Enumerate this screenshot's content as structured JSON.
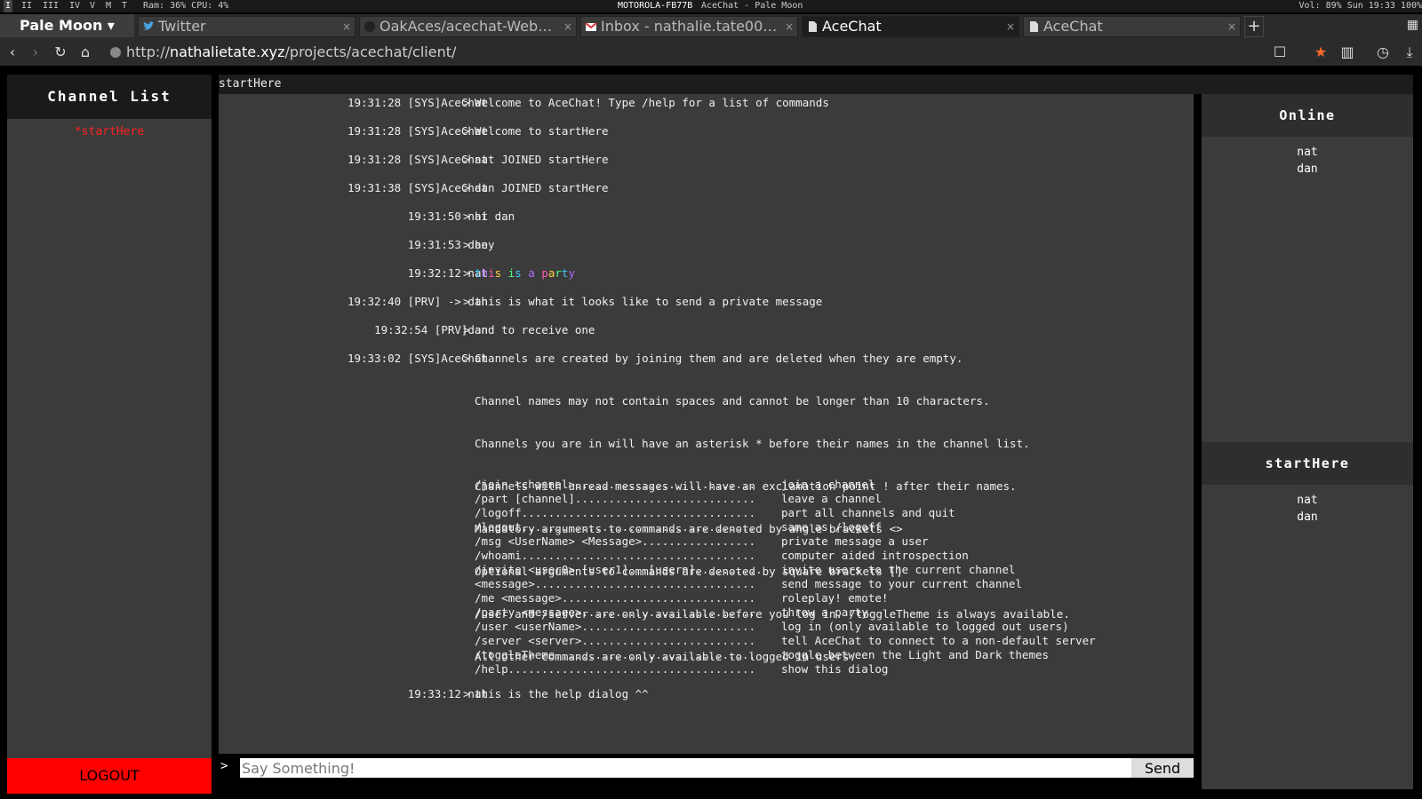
{
  "wm": {
    "workspaces": [
      "I",
      "II",
      "III",
      "IV",
      "V",
      "M",
      "T"
    ],
    "stats": "Ram: 36% CPU: 4%",
    "title": "MOTOROLA-FB77B",
    "title_app": "AceChat - Pale Moon",
    "right": "Vol: 89% Sun 19:33 100%"
  },
  "browser": {
    "app_menu": "Pale Moon ▾",
    "tabs": [
      {
        "label": "Twitter"
      },
      {
        "label": "OakAces/acechat-WebCli..."
      },
      {
        "label": "Inbox - nathalie.tate00@..."
      },
      {
        "label": "AceChat"
      },
      {
        "label": "AceChat"
      }
    ],
    "url_domain": "nathalietate.xyz",
    "url_prefix": "http://",
    "url_path": "/projects/acechat/client/"
  },
  "chat": {
    "channel_list_title": "Channel List",
    "channels": [
      "*startHere"
    ],
    "logout": "LOGOUT",
    "current_channel": "startHere",
    "messages": [
      {
        "meta": "19:31:28 [SYS]AceChat",
        "text": "Welcome to AceChat! Type /help for a list of commands"
      },
      {
        "meta": "19:31:28 [SYS]AceChat",
        "text": "Welcome to startHere"
      },
      {
        "meta": "19:31:28 [SYS]AceChat",
        "text": "nat JOINED startHere"
      },
      {
        "meta": "19:31:38 [SYS]AceChat",
        "text": "dan JOINED startHere"
      },
      {
        "meta": "19:31:50 nat",
        "text": "hi dan"
      },
      {
        "meta": "19:31:53 dan",
        "text": "hey"
      },
      {
        "meta": "19:32:12 nat",
        "text": "this is a party"
      },
      {
        "meta": "19:32:40 [PRV] -> dan",
        "text": "this is what it looks like to send a private message"
      },
      {
        "meta": "19:32:54 [PRV]dan",
        "text": "and to receive one"
      },
      {
        "meta": "19:33:02 [SYS]AceChat",
        "text": "Channels are created by joining them and are deleted when they are empty."
      },
      {
        "meta": "19:33:12 nat",
        "text": "this is the help dialog ^^"
      }
    ],
    "help_lines": [
      "Channel names may not contain spaces and cannot be longer than 10 characters.",
      "Channels you are in will have an asterisk * before their names in the channel list.",
      "Channels with unread messages will have an exclamation point ! after their names.",
      "Mandatory arguments to commands are denoted by angle brackets <>",
      "Optional arguments to commands are denoted by square brackets []",
      "/user and /server are only available before you log in. /toggleTheme is always available.",
      "All other commands are only available to logged in users."
    ],
    "help_commands": [
      {
        "cmd": "/join <channel>...........................",
        "desc": "join a channel"
      },
      {
        "cmd": "/part [channel]...........................",
        "desc": "leave a channel"
      },
      {
        "cmd": "/logoff...................................",
        "desc": "part all channels and quit"
      },
      {
        "cmd": "/logout...................................",
        "desc": "same as /logoff"
      },
      {
        "cmd": "/msg <UserName> <Message>.................",
        "desc": "private message a user"
      },
      {
        "cmd": "/whoami...................................",
        "desc": "computer aided introspection"
      },
      {
        "cmd": "/invite <user0> [user1]...[usern]..........",
        "desc": "invite users to the current channel"
      },
      {
        "cmd": "<message>.................................",
        "desc": "send message to your current channel"
      },
      {
        "cmd": "/me <message>.............................",
        "desc": "roleplay! emote!"
      },
      {
        "cmd": "/party <message>..........................",
        "desc": "throw a party"
      },
      {
        "cmd": "/user <userName>..........................",
        "desc": "log in (only available to logged out users)"
      },
      {
        "cmd": "/server <server>..........................",
        "desc": "tell AceChat to connect to a non-default server"
      },
      {
        "cmd": "/toggleTheme..............................",
        "desc": "toggle between the Light and Dark themes"
      },
      {
        "cmd": "/help.....................................",
        "desc": "show this dialog"
      }
    ],
    "input_placeholder": "Say Something!",
    "send_label": "Send",
    "prompt": ">",
    "online_title": "Online",
    "online_users": [
      "nat",
      "dan"
    ],
    "channel_users_title": "startHere",
    "channel_users": [
      "nat",
      "dan"
    ],
    "party_colors": [
      "#3ec9ff",
      "#b26bff",
      "#ff5ab4",
      "#ffd23e",
      "#4dff88"
    ]
  }
}
